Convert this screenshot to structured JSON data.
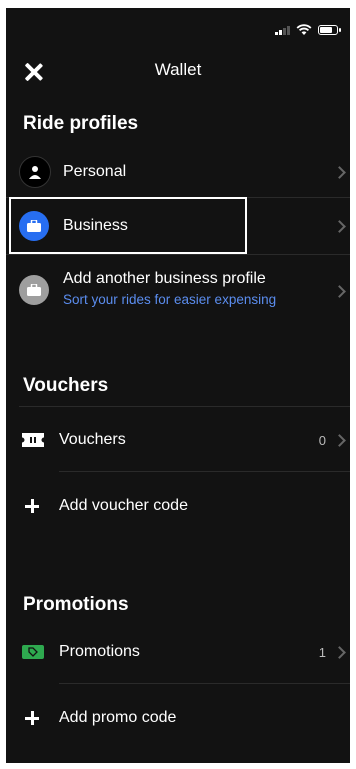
{
  "header": {
    "title": "Wallet",
    "close_icon": "close-icon"
  },
  "ride_profiles": {
    "title": "Ride profiles",
    "items": [
      {
        "label": "Personal",
        "icon": "person-icon"
      },
      {
        "label": "Business",
        "icon": "briefcase-icon"
      },
      {
        "label": "Add another business profile",
        "subtitle": "Sort your rides for easier expensing",
        "icon": "briefcase-icon"
      }
    ]
  },
  "vouchers": {
    "title": "Vouchers",
    "item_label": "Vouchers",
    "item_count": "0",
    "add_label": "Add voucher code"
  },
  "promotions": {
    "title": "Promotions",
    "item_label": "Promotions",
    "item_count": "1",
    "add_label": "Add promo code"
  },
  "colors": {
    "background": "#121212",
    "accent_blue": "#276ef1",
    "link_blue": "#5b8def",
    "promo_green": "#2ea94f",
    "gray_icon": "#9e9e9e"
  }
}
